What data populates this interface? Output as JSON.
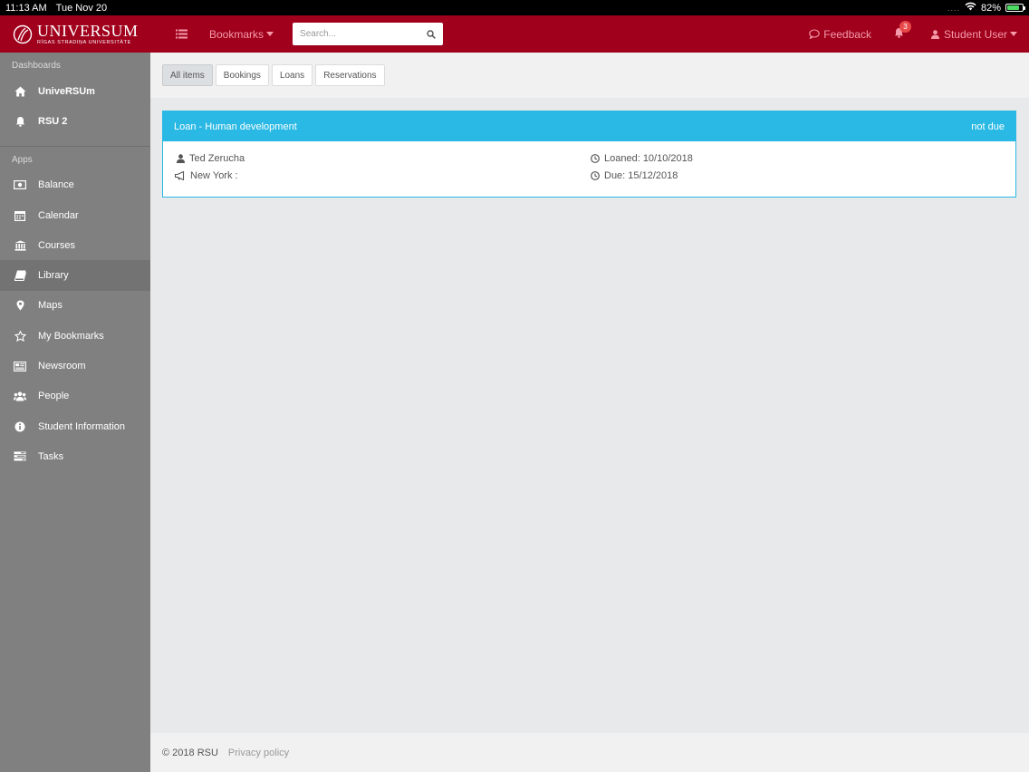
{
  "status_bar": {
    "time": "11:13 AM",
    "date": "Tue Nov 20",
    "battery": "82%",
    "battery_level": 0.82
  },
  "brand": {
    "name": "UNIVERSUM",
    "subtitle": "RĪGAS STRADIŅA UNIVERSITĀTE"
  },
  "navbar": {
    "bookmarks_label": "Bookmarks",
    "search_placeholder": "Search...",
    "feedback_label": "Feedback",
    "notification_count": "3",
    "user_label": "Student User"
  },
  "sidebar": {
    "dashboards_label": "Dashboards",
    "dashboards": [
      {
        "label": "UniveRSUm",
        "icon": "home-icon"
      },
      {
        "label": "RSU 2",
        "icon": "bell-icon"
      }
    ],
    "apps_label": "Apps",
    "apps": [
      {
        "label": "Balance",
        "icon": "money-icon"
      },
      {
        "label": "Calendar",
        "icon": "calendar-icon"
      },
      {
        "label": "Courses",
        "icon": "institution-icon"
      },
      {
        "label": "Library",
        "icon": "book-icon",
        "active": true
      },
      {
        "label": "Maps",
        "icon": "map-marker-icon"
      },
      {
        "label": "My Bookmarks",
        "icon": "star-icon"
      },
      {
        "label": "Newsroom",
        "icon": "newspaper-icon"
      },
      {
        "label": "People",
        "icon": "users-icon"
      },
      {
        "label": "Student Information",
        "icon": "info-circle-icon"
      },
      {
        "label": "Tasks",
        "icon": "tasks-icon"
      }
    ]
  },
  "tabs": [
    {
      "label": "All items",
      "active": true
    },
    {
      "label": "Bookings"
    },
    {
      "label": "Loans"
    },
    {
      "label": "Reservations"
    }
  ],
  "loan_card": {
    "title": "Loan - Human development",
    "status": "not due",
    "person": "Ted Zerucha",
    "location": "New York :",
    "loaned": "Loaned: 10/10/2018",
    "due": "Due: 15/12/2018"
  },
  "footer": {
    "copyright": "© 2018 RSU",
    "privacy_label": "Privacy policy"
  },
  "colors": {
    "brand": "#a0001c",
    "nav_link": "#f59aa9",
    "card_accent": "#2ab9e4",
    "sidebar": "#808080"
  }
}
